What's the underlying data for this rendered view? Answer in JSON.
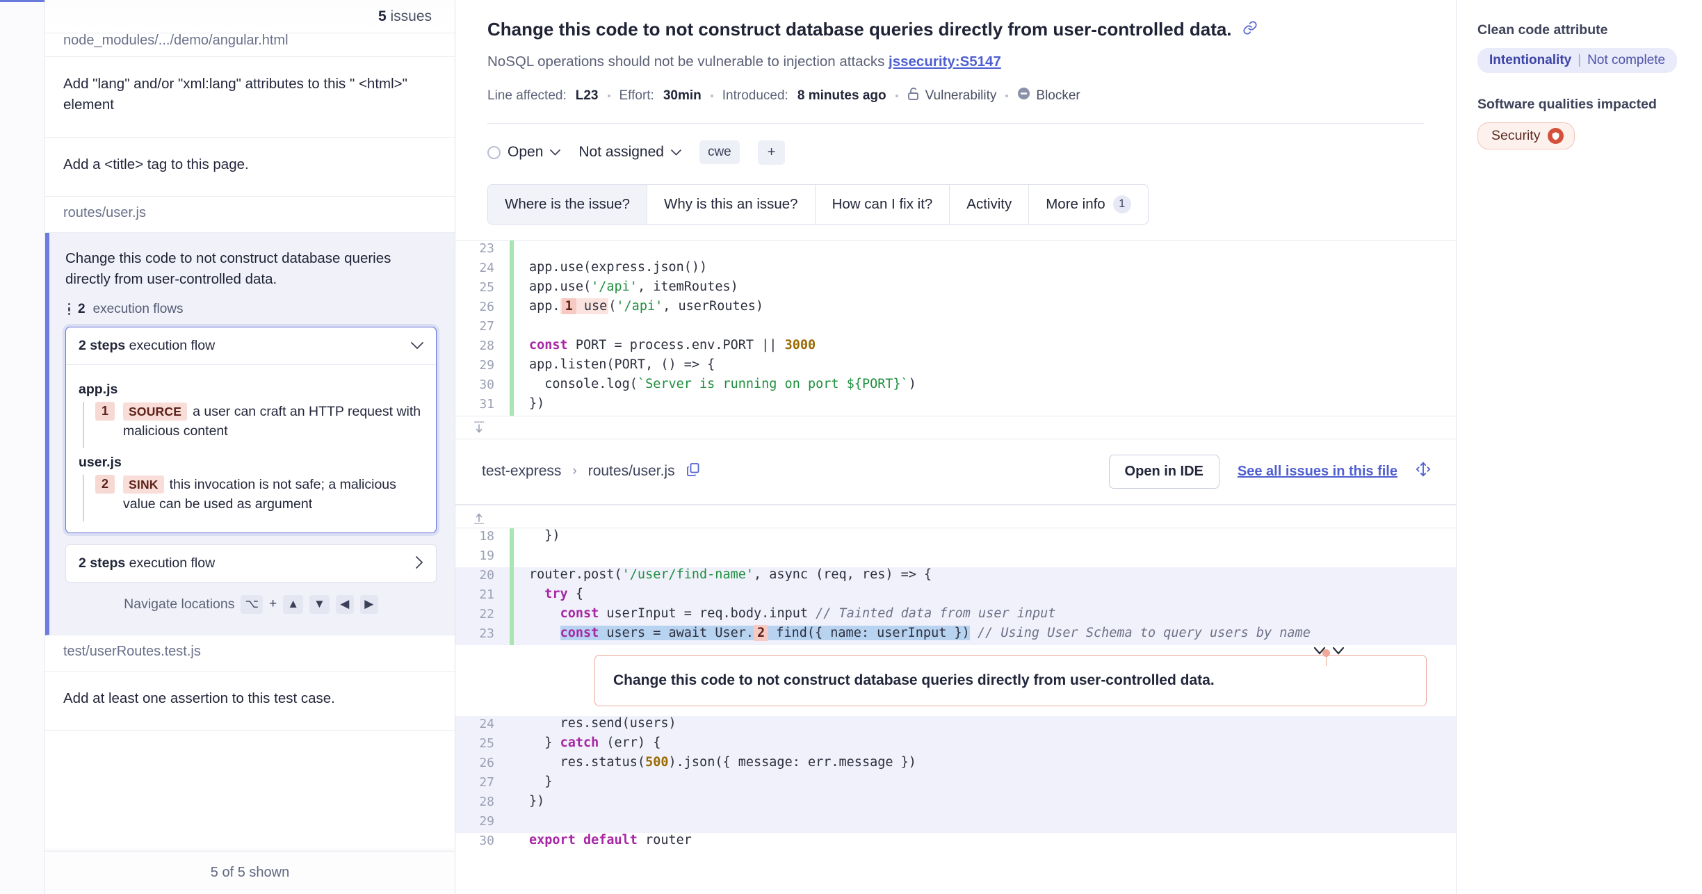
{
  "sidebar": {
    "issues_count": "5",
    "issues_label": "issues",
    "clipped_file": "node_modules/.../demo/angular.html",
    "issue_1": "Add \"lang\" and/or \"xml:lang\" attributes to this \" <html>\" element",
    "issue_2": "Add a <title> tag to this page.",
    "file_routes": "routes/user.js",
    "selected_issue": "Change this code to not construct database queries directly from user-controlled data.",
    "flows_count": "2",
    "flows_label": "execution flows",
    "flow_open": {
      "steps": "2 steps",
      "label": "execution flow",
      "chevron": "⌄"
    },
    "flow_closed": {
      "steps": "2 steps",
      "label": "execution flow",
      "chevron": "›"
    },
    "flow_groups": [
      {
        "file": "app.js",
        "steps": [
          {
            "num": "1",
            "tag": "SOURCE",
            "text": "a user can craft an HTTP request with malicious content"
          }
        ]
      },
      {
        "file": "user.js",
        "steps": [
          {
            "num": "2",
            "tag": "SINK",
            "text": "this invocation is not safe; a malicious value can be used as argument"
          }
        ]
      }
    ],
    "navigate": {
      "label": "Navigate locations",
      "key_alt": "⌥",
      "plus": "+",
      "key_up": "▲",
      "key_down": "▼",
      "key_left": "◀",
      "key_right": "▶"
    },
    "file_test": "test/userRoutes.test.js",
    "issue_3": "Add at least one assertion to this test case.",
    "footer": "5 of 5 shown"
  },
  "header": {
    "title": "Change this code to not construct database queries directly from user-controlled data.",
    "link_icon": "🔗",
    "subtitle": "NoSQL operations should not be vulnerable to injection attacks",
    "rule_key": "jssecurity:S5147",
    "meta": {
      "line_label": "Line affected:",
      "line_value": "L23",
      "effort_label": "Effort:",
      "effort_value": "30min",
      "introduced_label": "Introduced:",
      "introduced_value": "8 minutes ago",
      "type_label": "Vulnerability",
      "severity_label": "Blocker"
    }
  },
  "status_row": {
    "status": "Open",
    "assignee": "Not assigned",
    "tag": "cwe",
    "add_tag": "+"
  },
  "tabs": [
    {
      "label": "Where is the issue?",
      "active": true,
      "badge": ""
    },
    {
      "label": "Why is this an issue?",
      "active": false,
      "badge": ""
    },
    {
      "label": "How can I fix it?",
      "active": false,
      "badge": ""
    },
    {
      "label": "Activity",
      "active": false,
      "badge": ""
    },
    {
      "label": "More info",
      "active": false,
      "badge": "1"
    }
  ],
  "code_top": {
    "lines": [
      {
        "n": "23",
        "html": ""
      },
      {
        "n": "24",
        "html": "app.use(express.json())"
      },
      {
        "n": "25",
        "html": "app.use(<span class=\"str\">'/api'</span>, itemRoutes)"
      },
      {
        "n": "26",
        "html": "app.<span class=\"marksoft\"><span class=\"mark\">1</span> use</span>(<span class=\"str\">'/api'</span>, userRoutes)"
      },
      {
        "n": "27",
        "html": ""
      },
      {
        "n": "28",
        "html": "<span class=\"kw\">const</span> PORT = process.env.PORT || <span class=\"num\">3000</span>"
      },
      {
        "n": "29",
        "html": "app.listen(PORT, () =&gt; {"
      },
      {
        "n": "30",
        "html": "  console.log(<span class=\"str\">`Server is running on port ${PORT}`</span>)"
      },
      {
        "n": "31",
        "html": "})"
      }
    ]
  },
  "file_header": {
    "project": "test-express",
    "separator": "›",
    "path": "routes/user.js",
    "copy_icon": "copy",
    "open_in_ide": "Open in IDE",
    "see_all_issues": "See all issues in this file",
    "expand_icon": "expand"
  },
  "code_bottom": {
    "lines_before": [
      {
        "n": "18",
        "html": "  })",
        "hl": false
      },
      {
        "n": "19",
        "html": "",
        "hl": false
      },
      {
        "n": "20",
        "html": "router.post(<span class=\"str\">'/user/find-name'</span>, async (req, res) =&gt; {",
        "hl": true
      },
      {
        "n": "21",
        "html": "  <span class=\"kw\">try</span> {",
        "hl": true
      },
      {
        "n": "22",
        "html": "    <span class=\"kw\">const</span> userInput = req.body.input <span class=\"cmt\">// Tainted data from user input</span>",
        "hl": true
      },
      {
        "n": "23",
        "html": "    <span class=\"sel\"><span class=\"kw\">const</span> users = await User.<span class=\"mark\">2</span> find({ name: userInput })</span> <span class=\"cmt\">// Using User Schema to query users by name</span>",
        "hl": true
      }
    ],
    "callout": "Change this code to not construct database queries directly from user-controlled data.",
    "lines_after": [
      {
        "n": "24",
        "html": "    res.send(users)",
        "hl": true
      },
      {
        "n": "25",
        "html": "  } <span class=\"kw\">catch</span> (err) {",
        "hl": true
      },
      {
        "n": "26",
        "html": "    res.status(<span class=\"num\">500</span>).json({ message: err.message })",
        "hl": true
      },
      {
        "n": "27",
        "html": "  }",
        "hl": true
      },
      {
        "n": "28",
        "html": "})",
        "hl": true
      },
      {
        "n": "29",
        "html": "",
        "hl": true
      },
      {
        "n": "30",
        "html": "<span class=\"kw\">export default</span> router",
        "hl": false
      }
    ]
  },
  "rail": {
    "clean_code_heading": "Clean code attribute",
    "attribute_name": "Intentionality",
    "attribute_divider": "|",
    "attribute_value": "Not complete",
    "qualities_heading": "Software qualities impacted",
    "quality": "Security"
  },
  "colors": {
    "accent_blue": "#4f5fd1",
    "selection_blue": "#b7d3f0",
    "marker_red": "#d4503a",
    "flow_highlight": "#f1f1fb",
    "green_bar": "#a8e5b0"
  }
}
